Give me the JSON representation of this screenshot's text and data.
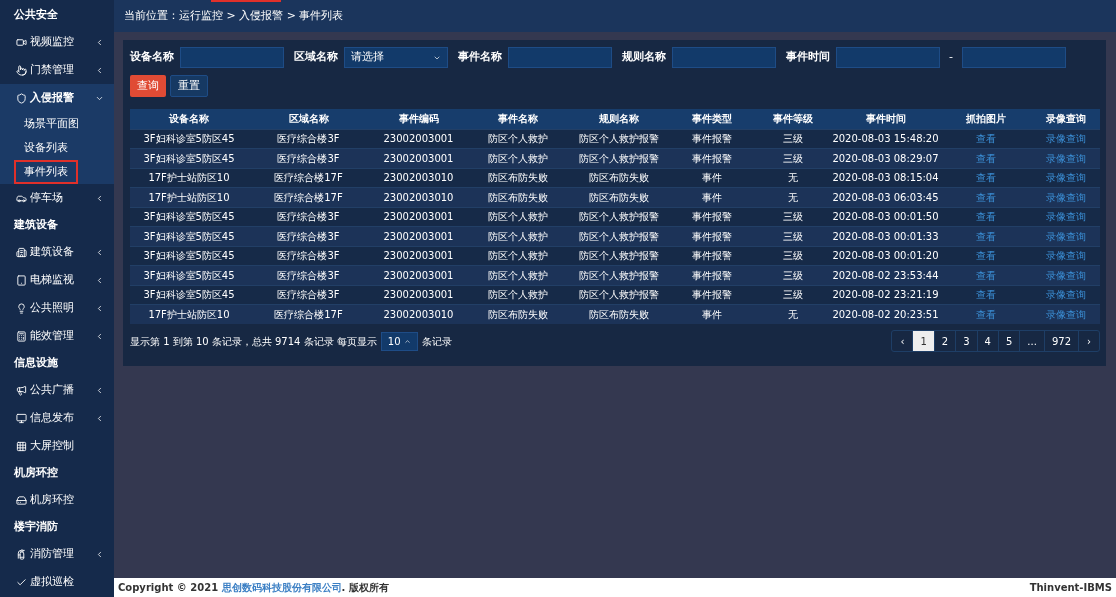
{
  "sidebar": {
    "items": [
      {
        "kind": "header",
        "label": "公共安全"
      },
      {
        "kind": "item",
        "label": "视频监控",
        "expanded": false
      },
      {
        "kind": "item",
        "label": "门禁管理",
        "expanded": false
      },
      {
        "kind": "item",
        "label": "入侵报警",
        "expanded": true,
        "children": [
          {
            "label": "场景平面图",
            "selected": false
          },
          {
            "label": "设备列表",
            "selected": false
          },
          {
            "label": "事件列表",
            "selected": true
          }
        ]
      },
      {
        "kind": "item",
        "label": "停车场",
        "expanded": false
      },
      {
        "kind": "header",
        "label": "建筑设备"
      },
      {
        "kind": "item",
        "label": "建筑设备",
        "expanded": false
      },
      {
        "kind": "item",
        "label": "电梯监视",
        "expanded": false
      },
      {
        "kind": "item",
        "label": "公共照明",
        "expanded": false
      },
      {
        "kind": "item",
        "label": "能效管理",
        "expanded": false
      },
      {
        "kind": "header",
        "label": "信息设施"
      },
      {
        "kind": "item",
        "label": "公共广播",
        "expanded": false
      },
      {
        "kind": "item",
        "label": "信息发布",
        "expanded": false
      },
      {
        "kind": "item",
        "label": "大屏控制"
      },
      {
        "kind": "header",
        "label": "机房环控"
      },
      {
        "kind": "item",
        "label": "机房环控"
      },
      {
        "kind": "header",
        "label": "楼宇消防"
      },
      {
        "kind": "item",
        "label": "消防管理",
        "expanded": false
      },
      {
        "kind": "item",
        "label": "虚拟巡检"
      }
    ]
  },
  "breadcrumb": "当前位置：运行监控 > 入侵报警 > 事件列表",
  "filters": [
    {
      "kind": "text",
      "label": "设备名称"
    },
    {
      "kind": "select",
      "label": "区域名称",
      "value": "请选择"
    },
    {
      "kind": "text",
      "label": "事件名称"
    },
    {
      "kind": "text",
      "label": "规则名称"
    },
    {
      "kind": "range",
      "label": "事件时间",
      "separator": "-"
    }
  ],
  "buttons": [
    {
      "kind": "primary",
      "label": "查询"
    },
    {
      "kind": "default",
      "label": "重置"
    }
  ],
  "table": {
    "columns": [
      "设备名称",
      "区域名称",
      "事件编码",
      "事件名称",
      "规则名称",
      "事件类型",
      "事件等级",
      "事件时间",
      "抓拍图片",
      "录像查询"
    ],
    "rows": [
      [
        "3F妇科诊室5防区45",
        "医疗综合楼3F",
        "23002003001",
        "防区个人救护",
        "防区个人救护报警",
        "事件报警",
        "三级",
        "2020-08-03 15:48:20",
        "查看",
        "录像查询"
      ],
      [
        "3F妇科诊室5防区45",
        "医疗综合楼3F",
        "23002003001",
        "防区个人救护",
        "防区个人救护报警",
        "事件报警",
        "三级",
        "2020-08-03 08:29:07",
        "查看",
        "录像查询"
      ],
      [
        "17F护士站防区10",
        "医疗综合楼17F",
        "23002003010",
        "防区布防失败",
        "防区布防失败",
        "事件",
        "无",
        "2020-08-03 08:15:04",
        "查看",
        "录像查询"
      ],
      [
        "17F护士站防区10",
        "医疗综合楼17F",
        "23002003010",
        "防区布防失败",
        "防区布防失败",
        "事件",
        "无",
        "2020-08-03 06:03:45",
        "查看",
        "录像查询"
      ],
      [
        "3F妇科诊室5防区45",
        "医疗综合楼3F",
        "23002003001",
        "防区个人救护",
        "防区个人救护报警",
        "事件报警",
        "三级",
        "2020-08-03 00:01:50",
        "查看",
        "录像查询"
      ],
      [
        "3F妇科诊室5防区45",
        "医疗综合楼3F",
        "23002003001",
        "防区个人救护",
        "防区个人救护报警",
        "事件报警",
        "三级",
        "2020-08-03 00:01:33",
        "查看",
        "录像查询"
      ],
      [
        "3F妇科诊室5防区45",
        "医疗综合楼3F",
        "23002003001",
        "防区个人救护",
        "防区个人救护报警",
        "事件报警",
        "三级",
        "2020-08-03 00:01:20",
        "查看",
        "录像查询"
      ],
      [
        "3F妇科诊室5防区45",
        "医疗综合楼3F",
        "23002003001",
        "防区个人救护",
        "防区个人救护报警",
        "事件报警",
        "三级",
        "2020-08-02 23:53:44",
        "查看",
        "录像查询"
      ],
      [
        "3F妇科诊室5防区45",
        "医疗综合楼3F",
        "23002003001",
        "防区个人救护",
        "防区个人救护报警",
        "事件报警",
        "三级",
        "2020-08-02 23:21:19",
        "查看",
        "录像查询"
      ],
      [
        "17F护士站防区10",
        "医疗综合楼17F",
        "23002003010",
        "防区布防失败",
        "防区布防失败",
        "事件",
        "无",
        "2020-08-02 20:23:51",
        "查看",
        "录像查询"
      ]
    ]
  },
  "summary": {
    "text": "显示第 1 到第 10 条记录，总共 9714 条记录 每页显示",
    "page_size": "10",
    "suffix": "条记录"
  },
  "pagination": {
    "prev": "‹",
    "next": "›",
    "pages": [
      {
        "label": "1",
        "selected": true
      },
      {
        "label": "2",
        "selected": false
      },
      {
        "label": "3",
        "selected": false
      },
      {
        "label": "4",
        "selected": false
      },
      {
        "label": "5",
        "selected": false
      },
      {
        "label": "...",
        "selected": false
      },
      {
        "label": "972",
        "selected": false
      }
    ]
  },
  "footer": {
    "prefix": "Copyright © 2021 ",
    "company": "思创数码科技股份有限公司",
    "suffix": ". 版权所有",
    "brand": "Thinvent-IBMS"
  }
}
